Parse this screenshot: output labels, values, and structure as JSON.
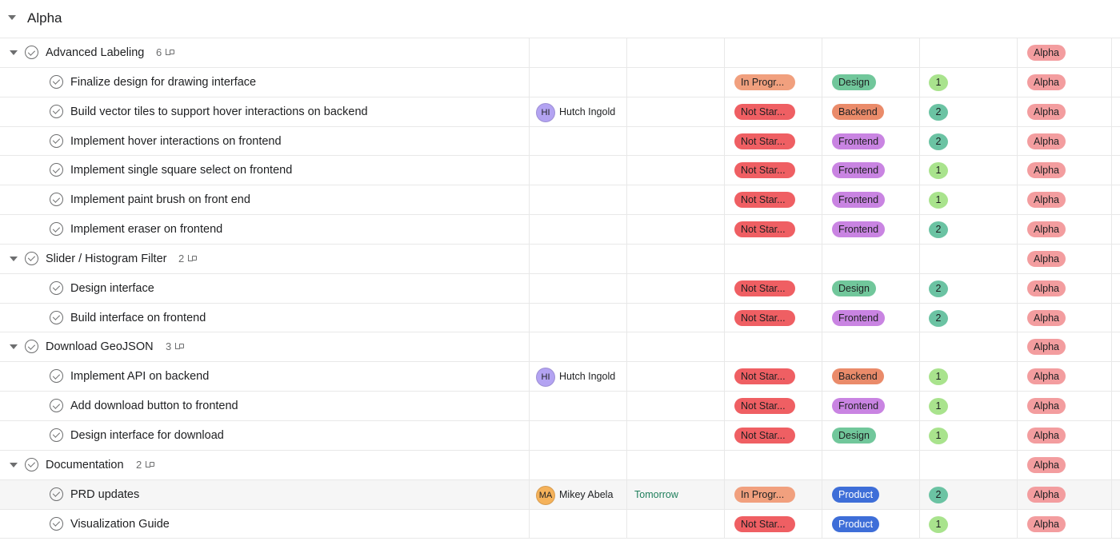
{
  "section": {
    "title": "Alpha"
  },
  "colors": {
    "in_progress": "#f1a07e",
    "not_started": "#ef5f63",
    "design": "#71c79b",
    "backend": "#ea8b6a",
    "frontend": "#c984e2",
    "product": "#3e6ed8",
    "prio_1": "#a9e38d",
    "prio_2": "#6bc3a3",
    "phase_alpha": "#f39d9f",
    "due_green": "#1f7f5c",
    "avatar_hi": "#b3a3f2",
    "avatar_ma": "#f5b25a"
  },
  "rows": [
    {
      "kind": "parent",
      "name": "Advanced Labeling",
      "subtasks": "6",
      "phase": "Alpha"
    },
    {
      "kind": "child",
      "name": "Finalize design for drawing interface",
      "status": "In Progr...",
      "status_key": "in_progress",
      "type": "Design",
      "type_key": "design",
      "priority": "1",
      "phase": "Alpha"
    },
    {
      "kind": "child",
      "name": "Build vector tiles to support hover interactions on backend",
      "assignee": {
        "initials": "HI",
        "name": "Hutch Ingold",
        "color_key": "avatar_hi"
      },
      "status": "Not Star...",
      "status_key": "not_started",
      "type": "Backend",
      "type_key": "backend",
      "priority": "2",
      "phase": "Alpha"
    },
    {
      "kind": "child",
      "name": "Implement hover interactions on frontend",
      "status": "Not Star...",
      "status_key": "not_started",
      "type": "Frontend",
      "type_key": "frontend",
      "priority": "2",
      "phase": "Alpha"
    },
    {
      "kind": "child",
      "name": "Implement single square select on frontend",
      "status": "Not Star...",
      "status_key": "not_started",
      "type": "Frontend",
      "type_key": "frontend",
      "priority": "1",
      "phase": "Alpha"
    },
    {
      "kind": "child",
      "name": "Implement paint brush on front end",
      "status": "Not Star...",
      "status_key": "not_started",
      "type": "Frontend",
      "type_key": "frontend",
      "priority": "1",
      "phase": "Alpha"
    },
    {
      "kind": "child",
      "name": "Implement eraser on frontend",
      "status": "Not Star...",
      "status_key": "not_started",
      "type": "Frontend",
      "type_key": "frontend",
      "priority": "2",
      "phase": "Alpha"
    },
    {
      "kind": "parent",
      "name": "Slider / Histogram Filter",
      "subtasks": "2",
      "phase": "Alpha"
    },
    {
      "kind": "child",
      "name": "Design interface",
      "status": "Not Star...",
      "status_key": "not_started",
      "type": "Design",
      "type_key": "design",
      "priority": "2",
      "phase": "Alpha"
    },
    {
      "kind": "child",
      "name": "Build interface on frontend",
      "status": "Not Star...",
      "status_key": "not_started",
      "type": "Frontend",
      "type_key": "frontend",
      "priority": "2",
      "phase": "Alpha"
    },
    {
      "kind": "parent",
      "name": "Download GeoJSON",
      "subtasks": "3",
      "phase": "Alpha"
    },
    {
      "kind": "child",
      "name": "Implement API on backend",
      "assignee": {
        "initials": "HI",
        "name": "Hutch Ingold",
        "color_key": "avatar_hi"
      },
      "status": "Not Star...",
      "status_key": "not_started",
      "type": "Backend",
      "type_key": "backend",
      "priority": "1",
      "phase": "Alpha"
    },
    {
      "kind": "child",
      "name": "Add download button to frontend",
      "status": "Not Star...",
      "status_key": "not_started",
      "type": "Frontend",
      "type_key": "frontend",
      "priority": "1",
      "phase": "Alpha"
    },
    {
      "kind": "child",
      "name": "Design interface for download",
      "status": "Not Star...",
      "status_key": "not_started",
      "type": "Design",
      "type_key": "design",
      "priority": "1",
      "phase": "Alpha"
    },
    {
      "kind": "parent",
      "name": "Documentation",
      "subtasks": "2",
      "phase": "Alpha"
    },
    {
      "kind": "child",
      "highlight": true,
      "name": "PRD updates",
      "assignee": {
        "initials": "MA",
        "name": "Mikey Abela",
        "color_key": "avatar_ma"
      },
      "due": "Tomorrow",
      "status": "In Progr...",
      "status_key": "in_progress",
      "type": "Product",
      "type_key": "product",
      "priority": "2",
      "phase": "Alpha"
    },
    {
      "kind": "child",
      "name": "Visualization Guide",
      "status": "Not Star...",
      "status_key": "not_started",
      "type": "Product",
      "type_key": "product",
      "priority": "1",
      "phase": "Alpha"
    }
  ]
}
